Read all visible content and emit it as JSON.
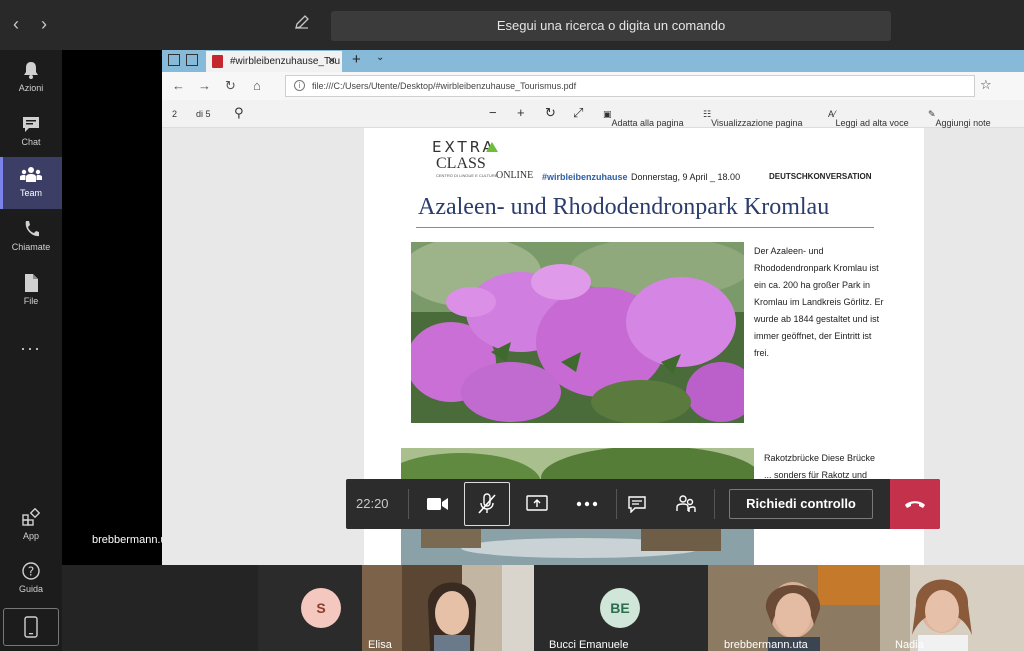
{
  "topbar": {
    "search_placeholder": "Esegui una ricerca o digita un comando"
  },
  "rail": {
    "items": [
      {
        "label": "Azioni"
      },
      {
        "label": "Chat"
      },
      {
        "label": "Team"
      },
      {
        "label": "Chiamate"
      },
      {
        "label": "File"
      },
      {
        "label": "App"
      },
      {
        "label": "Guida"
      }
    ],
    "more": "..."
  },
  "browser": {
    "tab_title": "#wirbleibenzuhause_Tou",
    "url": "file:///C:/Users/Utente/Desktop/#wirbleibenzuhause_Tourismus.pdf",
    "pdf_toolbar": {
      "page_current": "2",
      "page_total": "di 5",
      "fit_page": "Adatta alla pagina",
      "page_view": "Visualizzazione pagina",
      "read_aloud": "Leggi ad alta voce",
      "add_notes": "Aggiungi note"
    }
  },
  "document": {
    "logo_extra": "EXTRA",
    "logo_class": "CLASS",
    "logo_sub": "CENTRO DI LINGUE E CULTURE",
    "online": "ONLINE",
    "hashtag": "#wirbleibenzuhause",
    "event": "Donnerstag, 9 April _ 18.00",
    "event_bold": "DEUTSCHKONVERSATION",
    "title": "Azaleen- und Rhododendronpark Kromlau",
    "para1": "Der Azaleen- und Rhododendronpark Kromlau ist ein ca. 200 ha großer Park in Kromlau  im Landkreis Görlitz. Er wurde ab 1844 gestaltet und ist immer geöffnet, der Eintritt ist frei.",
    "para2": "Rakotzbrücke Diese Brücke ... sonders für Rakotz und wird auch Teufelsbrücke genannt."
  },
  "presenter_name": "brebbermann.uta",
  "controls": {
    "time": "22:20",
    "request_control": "Richiedi controllo"
  },
  "participants": [
    {
      "initials": "S",
      "name": ""
    },
    {
      "initials": "",
      "name": "Elisa"
    },
    {
      "initials": "BE",
      "name": "Bucci Emanuele"
    },
    {
      "initials": "",
      "name": "brebbermann.uta"
    },
    {
      "initials": "",
      "name": "Nadia"
    }
  ],
  "colors": {
    "team_accent": "#7b83eb",
    "hangup": "#c4314b",
    "title_blue": "#2a3d6d",
    "hashtag_blue": "#2e5fa8"
  }
}
